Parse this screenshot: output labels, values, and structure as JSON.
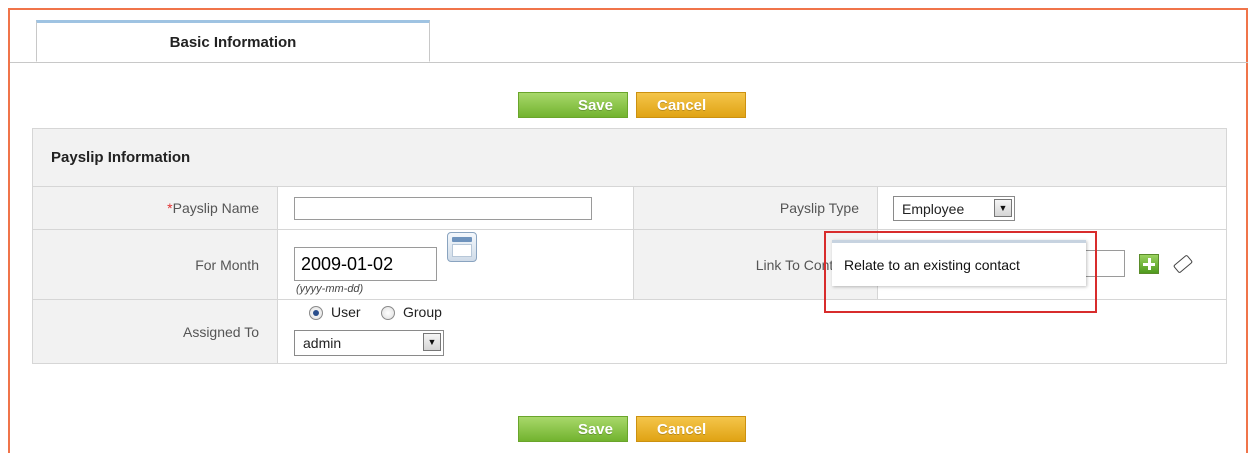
{
  "tabs": [
    {
      "label": "Basic Information",
      "active": true
    }
  ],
  "actions": {
    "save_label": "Save",
    "cancel_label": "Cancel"
  },
  "section": {
    "title": "Payslip Information"
  },
  "fields": {
    "payslip_name": {
      "required_mark": "*",
      "label": "Payslip Name",
      "value": ""
    },
    "payslip_type": {
      "label": "Payslip Type",
      "value": "Employee"
    },
    "for_month": {
      "label": "For Month",
      "value": "2009-01-02",
      "hint": "(yyyy-mm-dd)"
    },
    "link_to_contacts": {
      "label": "Link To Contacts",
      "value": ""
    },
    "assigned_to": {
      "label": "Assigned To",
      "option_user": "User",
      "option_group": "Group",
      "selected_option": "User",
      "value": "admin"
    }
  },
  "popup": {
    "item": "Relate to an existing contact"
  },
  "icons": {
    "calendar": "calendar-icon",
    "add": "plus-icon",
    "clear": "eraser-icon",
    "dropdown": "chevron-down-icon"
  },
  "colors": {
    "save": "#72b32f",
    "cancel": "#e0a314",
    "highlight": "#d82c2c",
    "frame": "#f0744a",
    "required": "#e03030"
  }
}
